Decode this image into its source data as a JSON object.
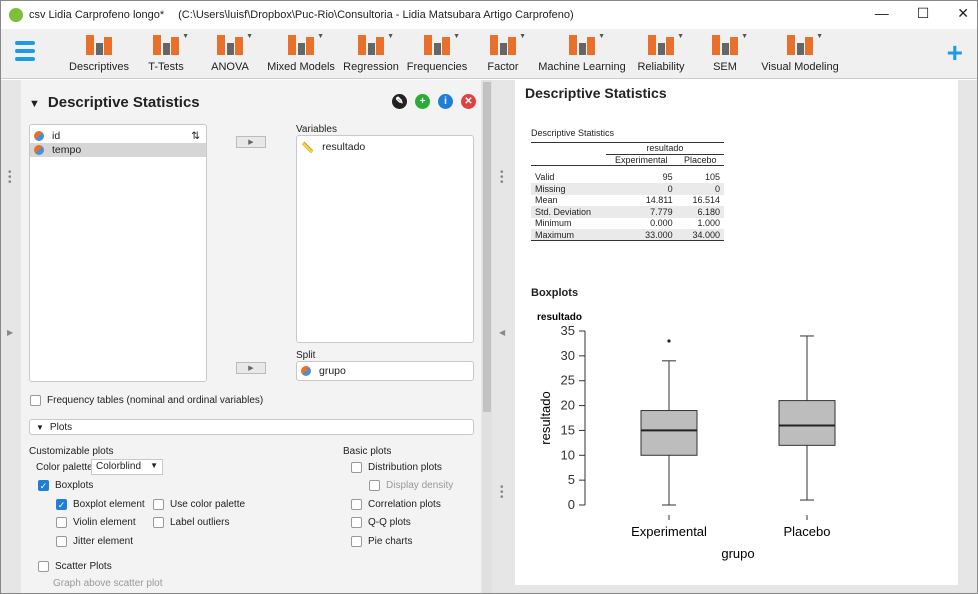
{
  "window": {
    "title": "csv Lidia Carprofeno longo*",
    "path": "(C:\\Users\\luisf\\Dropbox\\Puc-Rio\\Consultoria - Lidia Matsubara Artigo Carprofeno)",
    "min": "—",
    "max": "☐",
    "close": "✕"
  },
  "toolbar": {
    "items": [
      "Descriptives",
      "T-Tests",
      "ANOVA",
      "Mixed Models",
      "Regression",
      "Frequencies",
      "Factor",
      "Machine Learning",
      "Reliability",
      "SEM",
      "Visual Modeling"
    ],
    "plus": "+"
  },
  "left": {
    "title": "Descriptive Statistics",
    "source_vars": [
      "id",
      "tempo"
    ],
    "variables_label": "Variables",
    "variables": [
      "resultado"
    ],
    "split_label": "Split",
    "split": [
      "grupo"
    ],
    "freq_tables": "Frequency tables (nominal and ordinal variables)",
    "plots_section": "Plots",
    "customizable_label": "Customizable plots",
    "color_palette_label": "Color palette",
    "color_palette_value": "Colorblind",
    "boxplots": "Boxplots",
    "boxplot_element": "Boxplot element",
    "use_color_palette": "Use color palette",
    "violin_element": "Violin element",
    "label_outliers": "Label outliers",
    "jitter_element": "Jitter element",
    "scatter_plots": "Scatter Plots",
    "graph_above": "Graph above scatter plot",
    "basic_label": "Basic plots",
    "distribution_plots": "Distribution plots",
    "display_density": "Display density",
    "correlation_plots": "Correlation plots",
    "qq_plots": "Q-Q plots",
    "pie_charts": "Pie charts"
  },
  "right": {
    "title": "Descriptive Statistics",
    "table_title": "Descriptive Statistics",
    "var_header": "resultado",
    "cols": [
      "Experimental",
      "Placebo"
    ],
    "rows": [
      [
        "Valid",
        "95",
        "105"
      ],
      [
        "Missing",
        "0",
        "0"
      ],
      [
        "Mean",
        "14.811",
        "16.514"
      ],
      [
        "Std. Deviation",
        "7.779",
        "6.180"
      ],
      [
        "Minimum",
        "0.000",
        "1.000"
      ],
      [
        "Maximum",
        "33.000",
        "34.000"
      ]
    ],
    "boxplots_title": "Boxplots"
  },
  "chart_data": {
    "type": "box",
    "title": "resultado",
    "xlabel": "grupo",
    "ylabel": "resultado",
    "ylim": [
      0,
      35
    ],
    "yticks": [
      "0",
      "5",
      "10",
      "15",
      "20",
      "25",
      "30",
      "35"
    ],
    "categories": [
      "Experimental",
      "Placebo"
    ],
    "series": [
      {
        "name": "Experimental",
        "min": 0,
        "q1": 10,
        "median": 15,
        "q3": 19,
        "max": 29,
        "outliers": [
          33
        ]
      },
      {
        "name": "Placebo",
        "min": 1,
        "q1": 12,
        "median": 16,
        "q3": 21,
        "max": 34,
        "outliers": []
      }
    ],
    "box_color": "#bdbdbd"
  }
}
